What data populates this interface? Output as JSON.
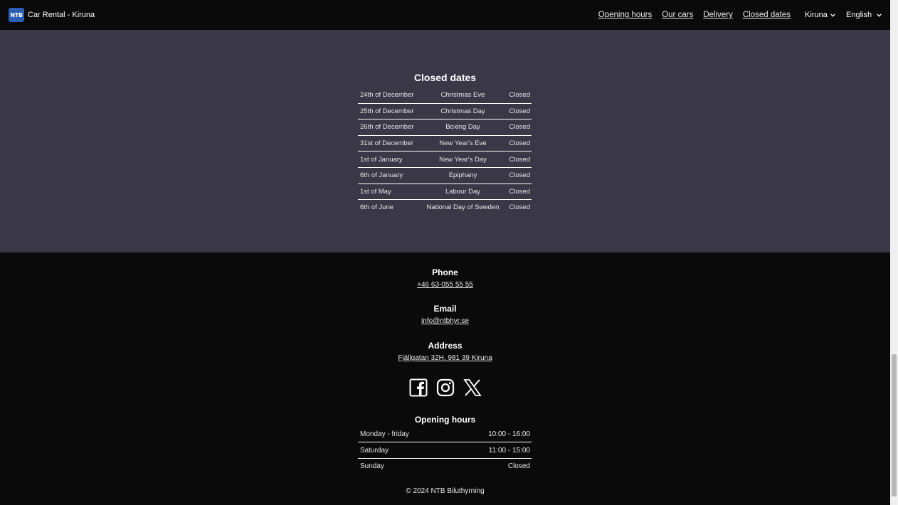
{
  "navbar": {
    "logo_text": "NTB",
    "title": "Car Rental - Kiruna",
    "links": [
      "Opening hours",
      "Our cars",
      "Delivery",
      "Closed dates"
    ],
    "city": "Kiruna",
    "language": "English"
  },
  "closed_dates": {
    "title": "Closed dates",
    "rows": [
      {
        "date": "24th of December",
        "holiday": "Christmas Eve",
        "status": "Closed"
      },
      {
        "date": "25th of December",
        "holiday": "Christmas Day",
        "status": "Closed"
      },
      {
        "date": "26th of December",
        "holiday": "Boxing Day",
        "status": "Closed"
      },
      {
        "date": "31st of December",
        "holiday": "New Year's Eve",
        "status": "Closed"
      },
      {
        "date": "1st of January",
        "holiday": "New Year's Day",
        "status": "Closed"
      },
      {
        "date": "6th of January",
        "holiday": "Epiphany",
        "status": "Closed"
      },
      {
        "date": "1st of May",
        "holiday": "Labour Day",
        "status": "Closed"
      },
      {
        "date": "6th of June",
        "holiday": "National Day of Sweden",
        "status": "Closed"
      }
    ]
  },
  "footer": {
    "phone_label": "Phone",
    "phone": "+46 63-055 55 55",
    "email_label": "Email",
    "email": "info@ntbhyr.se",
    "address_label": "Address",
    "address": "Fjällgatan 32H, 981 39 Kiruna",
    "social": [
      "facebook-icon",
      "instagram-icon",
      "x-icon"
    ],
    "opening_hours_title": "Opening hours",
    "opening_hours": [
      {
        "day": "Monday - friday",
        "time": "10:00 - 16:00"
      },
      {
        "day": "Saturday",
        "time": "11:00 - 15:00"
      },
      {
        "day": "Sunday",
        "time": "Closed"
      }
    ],
    "copyright": "© 2024 NTB Biluthyrning"
  },
  "colors": {
    "navbar_bg": "#0a0a0a",
    "section_bg": "#3a3747",
    "footer_bg": "#0a0a0a",
    "logo_bg": "#2b5fb3"
  }
}
